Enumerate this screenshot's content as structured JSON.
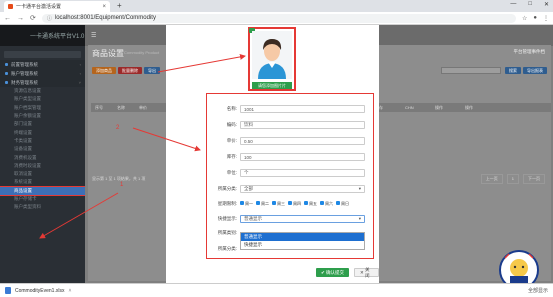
{
  "browser": {
    "tab_title": "一卡通平台激活设置",
    "url": "localhost:8001/Equipment/Commodity",
    "window_controls": [
      "—",
      "□",
      "✕"
    ]
  },
  "app": {
    "brand": "一卡通系统平台V1.0",
    "sidebar": {
      "groups": [
        {
          "label": "前置管理系统"
        },
        {
          "label": "账户管理系统"
        },
        {
          "label": "财务管理系统"
        }
      ],
      "items": [
        "资源信息设置",
        "账户类型设置",
        "账户档案管理",
        "账户余额设置",
        "部门设置",
        "终端设置",
        "卡类设置",
        "设备设置",
        "消费机设置",
        "消费时段设置",
        "取消设置",
        "系统设置",
        "商品设置",
        "账户存储卡",
        "账户类型资料"
      ],
      "active_item": "商品设置"
    },
    "page": {
      "title": "商品设置",
      "subtitle": "Commodity Product",
      "top_right": "平台管理事件档",
      "buttons": [
        "添加商品",
        "批量删除",
        "导出"
      ],
      "right_buttons": [
        "搜索",
        "导出报表"
      ],
      "table_headers": [
        "序号",
        "名称",
        "单价",
        "",
        "",
        "",
        "",
        "快捷显示",
        "库存",
        "CHN",
        "操作",
        "操作"
      ],
      "pager_text": "显示第 1 至 1 项结果，共 1 项",
      "pager_buttons": [
        "上一页",
        "1",
        "下一页"
      ]
    }
  },
  "modal": {
    "upload_button": "请您添加图片片",
    "fields": [
      {
        "label": "名称:",
        "value": "1001"
      },
      {
        "label": "编码:",
        "value": "饮料"
      },
      {
        "label": "单价:",
        "value": "0.50"
      },
      {
        "label": "库存:",
        "value": "100"
      },
      {
        "label": "单位:",
        "value": "个"
      },
      {
        "label": "所属分类:",
        "value": "全部"
      }
    ],
    "weekday_label": "星期限制:",
    "weekdays": [
      "周一",
      "周二",
      "周三",
      "周四",
      "周五",
      "周六",
      "周日"
    ],
    "quick_label": "快捷显示:",
    "quick_value": "普通显示",
    "dropdown_options": [
      "普通显示",
      "快捷显示"
    ],
    "extra_labels": [
      "所属类别:",
      "所属分类:"
    ],
    "save_button": "确认提交",
    "close_button": "关闭"
  },
  "annotations": {
    "mark_1": "1",
    "mark_2": "2"
  },
  "download": {
    "filename": "CommodityEven1.xlsx",
    "show_all": "全部显示"
  },
  "colors": {
    "accent_red": "#e53935",
    "accent_green": "#2e9e4c",
    "selection_blue": "#1e6fd0",
    "sidebar_active": "#3d6fb6"
  }
}
